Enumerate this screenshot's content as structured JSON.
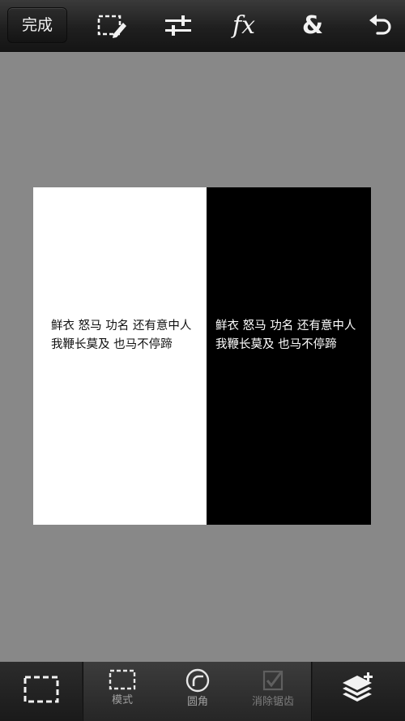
{
  "toolbar": {
    "done_label": "完成",
    "icons": [
      "selection-edit-icon",
      "adjust-sliders-icon",
      "fx-icon",
      "ampersand-icon",
      "undo-icon"
    ],
    "fx_label": "fx",
    "ampersand_label": "&"
  },
  "canvas": {
    "left_panel_color": "#ffffff",
    "right_panel_color": "#000000",
    "left_text": {
      "line1": "鲜衣  怒马  功名  还有意中人",
      "line2": "我鞭长莫及  也马不停蹄"
    },
    "right_text": {
      "line1": "鲜衣  怒马  功名  还有意中人",
      "line2": "我鞭长莫及  也马不停蹄"
    }
  },
  "bottom_bar": {
    "mode_label": "模式",
    "round_corner_label": "圆角",
    "antialias_label": "消除锯齿",
    "icons": [
      "selection-icon",
      "mode-icon",
      "round-corner-icon",
      "antialias-icon",
      "add-layer-icon"
    ]
  },
  "colors": {
    "workspace_bg": "#888888",
    "toolbar_bg": "#1f1f1f",
    "icon_color": "#f2f2f2"
  }
}
